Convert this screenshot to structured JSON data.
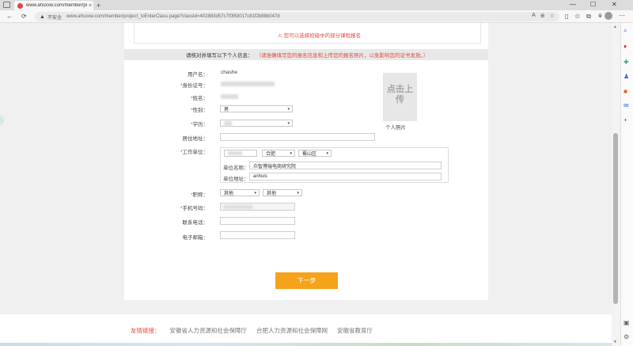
{
  "browser": {
    "tab_title": "www.ahsxxw.com/member/proj",
    "tab_close": "×",
    "new_tab": "+",
    "insecure_label": "不安全",
    "url": "www.ahsxxw.com/member/project_toEnterClass.page?classId=402883d57c7f0f63017c81f2b88b047d",
    "back": "←",
    "refresh": "⟳",
    "min": "—",
    "max": "☐",
    "close": "✕",
    "more": "⋯"
  },
  "notice": {
    "warning_text": "⚠ 您可以选择班级中的部分课程报名"
  },
  "banner": {
    "title": "请核对并填写以下个人信息：",
    "note": "（请准确填写您的报名信息和上传您的报名照片，以免影响您的证书发放。）"
  },
  "form": {
    "username_label": "用户名：",
    "username_value": "chashe",
    "idcard_label": "身份证号：",
    "name_label": "姓名：",
    "gender_label": "性别：",
    "gender_value": "男",
    "education_label": "学历：",
    "address_label": "居住地址：",
    "work_label": "工作单位：",
    "city_value": "合肥",
    "district_value": "蜀山区",
    "unit_name_label": "单位名称：",
    "unit_name_value": "众智博瑞电商研究院",
    "unit_addr_label": "单位地址：",
    "unit_addr_value": "anhuis",
    "title_label": "职称：",
    "title_value1": "其他",
    "title_value2": "其他",
    "phone_label": "手机号码：",
    "tel_label": "联系电话：",
    "email_label": "电子邮箱：",
    "required_mark": "*",
    "chevron": "▾"
  },
  "photo": {
    "upload_text": "点击上传",
    "caption": "个人照片"
  },
  "next_button": "下一步",
  "footer": {
    "title": "友情链接：",
    "links": [
      "安徽省人力资源和社会保障厅",
      "合肥人力资源和社会保障网",
      "安徽省教育厅"
    ]
  },
  "colors": {
    "accent": "#f5a31a",
    "required": "#e04a3a"
  }
}
